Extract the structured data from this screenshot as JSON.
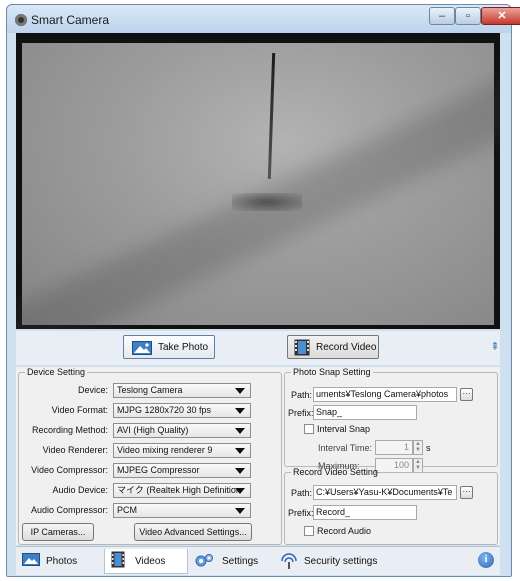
{
  "window": {
    "title": "Smart Camera",
    "min_glyph": "–",
    "max_glyph": "▫",
    "close_glyph": "✕"
  },
  "toolbar": {
    "take_photo_label": "Take Photo",
    "record_video_label": "Record Video",
    "collapse_glyph": "⇞"
  },
  "device_setting": {
    "legend": "Device Setting",
    "rows": [
      {
        "label": "Device:",
        "value": "Teslong Camera"
      },
      {
        "label": "Video Format:",
        "value": "MJPG 1280x720 30 fps"
      },
      {
        "label": "Recording Method:",
        "value": "AVI (High Quality)"
      },
      {
        "label": "Video Renderer:",
        "value": "Video mixing renderer 9"
      },
      {
        "label": "Video Compressor:",
        "value": "MJPEG Compressor"
      },
      {
        "label": "Audio Device:",
        "value": "マイク (Realtek High Definition"
      },
      {
        "label": "Audio Compressor:",
        "value": "PCM"
      }
    ],
    "ip_cameras_label": "IP Cameras...",
    "video_advanced_label": "Video Advanced Settings..."
  },
  "photo_snap": {
    "legend": "Photo Snap Setting",
    "path_label": "Path:",
    "path_value": "uments¥Teslong Camera¥photos",
    "prefix_label": "Prefix:",
    "prefix_value": "Snap_",
    "interval_snap_label": "Interval Snap",
    "interval_snap_checked": false,
    "interval_time_label": "Interval Time:",
    "interval_time_value": "1",
    "interval_unit": "s",
    "maximum_label": "Maximum:",
    "maximum_value": "100"
  },
  "record_video": {
    "legend": "Record Video Setting",
    "path_label": "Path:",
    "path_value": "C:¥Users¥Yasu-K¥Documents¥Te",
    "prefix_label": "Prefix:",
    "prefix_value": "Record_",
    "record_audio_label": "Record Audio",
    "record_audio_checked": false
  },
  "tabs": [
    {
      "label": "Photos",
      "active": false
    },
    {
      "label": "Videos",
      "active": true
    },
    {
      "label": "Settings",
      "active": false
    },
    {
      "label": "Security settings",
      "active": false
    }
  ],
  "info_glyph": "i",
  "colors": {
    "accent": "#2b66b4",
    "close": "#c4392c",
    "title_bar": "#cfe0f1"
  }
}
